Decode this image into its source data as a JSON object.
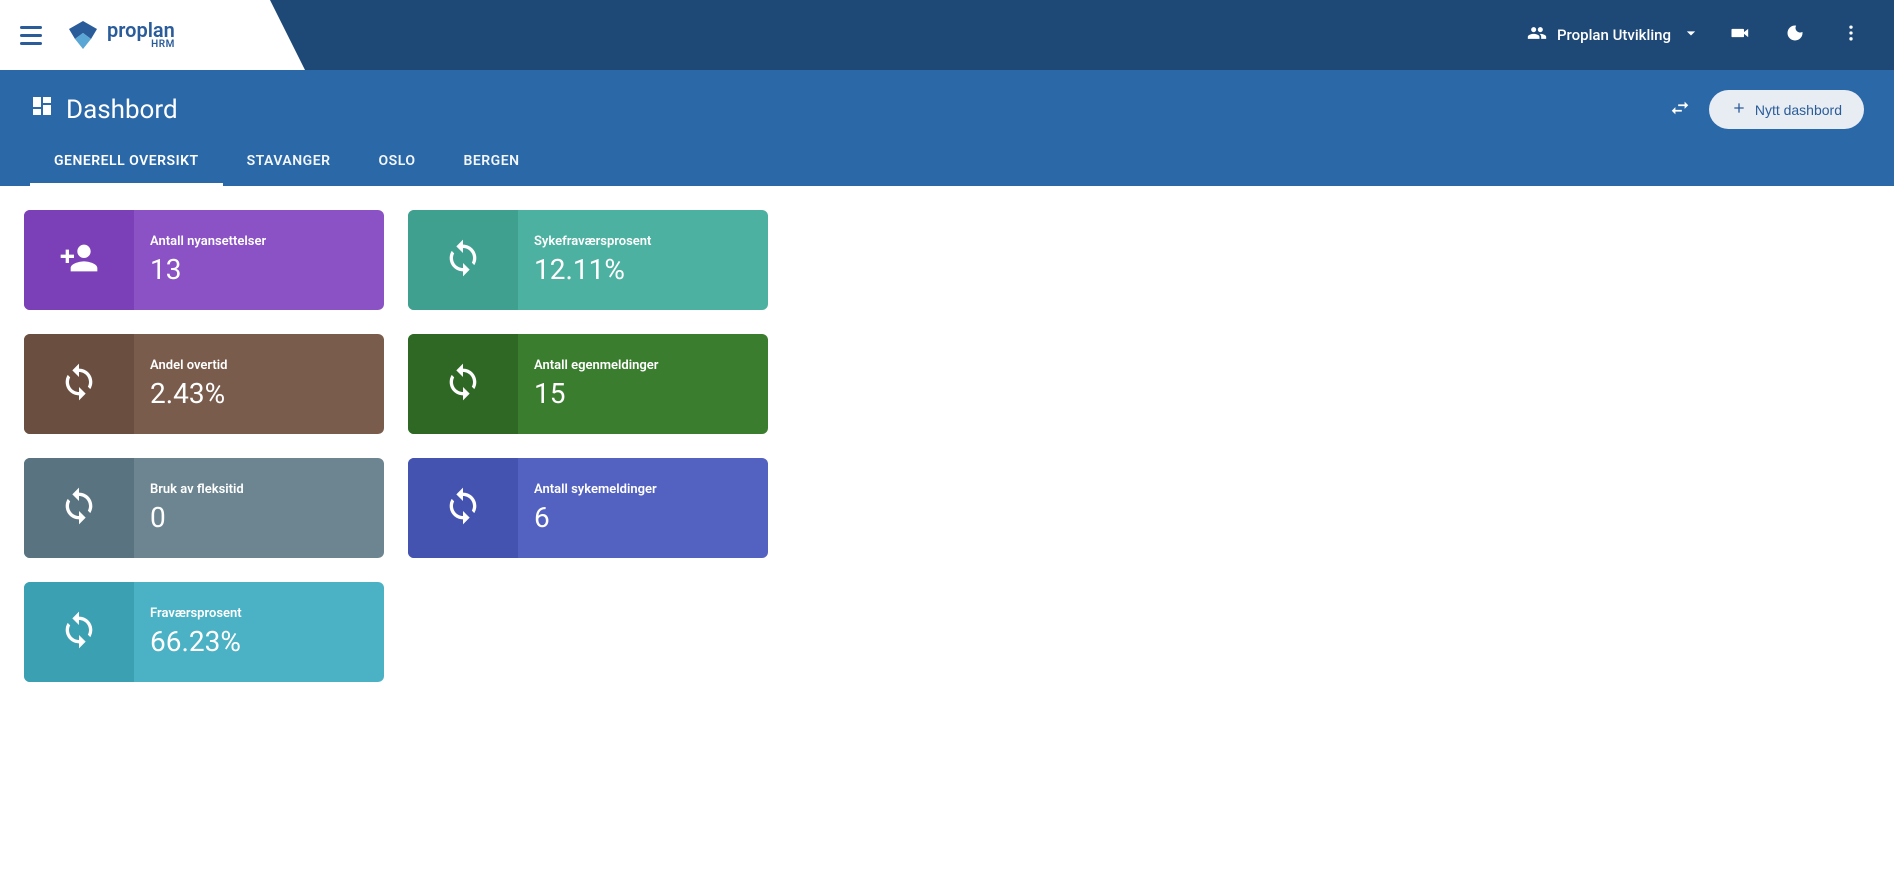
{
  "app": {
    "logo_main": "proplan",
    "logo_sub": "HRM"
  },
  "topbar": {
    "user_label": "Proplan Utvikling"
  },
  "page": {
    "title": "Dashbord",
    "new_dashboard_label": "Nytt dashbord"
  },
  "tabs": [
    {
      "label": "GENERELL OVERSIKT",
      "active": true
    },
    {
      "label": "STAVANGER",
      "active": false
    },
    {
      "label": "OSLO",
      "active": false
    },
    {
      "label": "BERGEN",
      "active": false
    }
  ],
  "cards": [
    {
      "label": "Antall nyansettelser",
      "value": "13",
      "color": "purple",
      "icon": "person-add"
    },
    {
      "label": "Sykefraværsprosent",
      "value": "12.11%",
      "color": "teal",
      "icon": "sync"
    },
    {
      "label": "Andel overtid",
      "value": "2.43%",
      "color": "brown",
      "icon": "sync"
    },
    {
      "label": "Antall egenmeldinger",
      "value": "15",
      "color": "green",
      "icon": "sync"
    },
    {
      "label": "Bruk av fleksitid",
      "value": "0",
      "color": "bluegrey",
      "icon": "sync"
    },
    {
      "label": "Antall sykemeldinger",
      "value": "6",
      "color": "indigo",
      "icon": "sync"
    },
    {
      "label": "Fraværsprosent",
      "value": "66.23%",
      "color": "cyan",
      "icon": "sync"
    }
  ]
}
